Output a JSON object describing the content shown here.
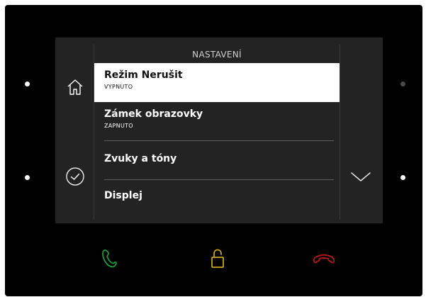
{
  "screen": {
    "title": "NASTAVENÍ"
  },
  "left_icons": [
    {
      "icon": "home-icon"
    },
    {
      "icon": "check-circle-icon"
    }
  ],
  "right_icons": [
    {
      "icon": "chevron-down-icon"
    }
  ],
  "menu": [
    {
      "label": "Režim Nerušit",
      "status": "VYPNUTO",
      "selected": true
    },
    {
      "label": "Zámek obrazovky",
      "status": "ZAPNUTO",
      "selected": false
    },
    {
      "label": "Zvuky a tóny",
      "status": "",
      "selected": false
    },
    {
      "label": "Displej",
      "status": "",
      "selected": false
    }
  ],
  "hardware_buttons": [
    {
      "icon": "phone-answer-icon",
      "color": "#1f9a3a"
    },
    {
      "icon": "unlock-icon",
      "color": "#c9a51e"
    },
    {
      "icon": "phone-hangup-icon",
      "color": "#b31b1b"
    }
  ],
  "colors": {
    "device": "#000000",
    "screen": "#232323",
    "selected_row": "#ffffff",
    "indicator_on": "#ffffff",
    "indicator_off": "#4a4a4a"
  }
}
